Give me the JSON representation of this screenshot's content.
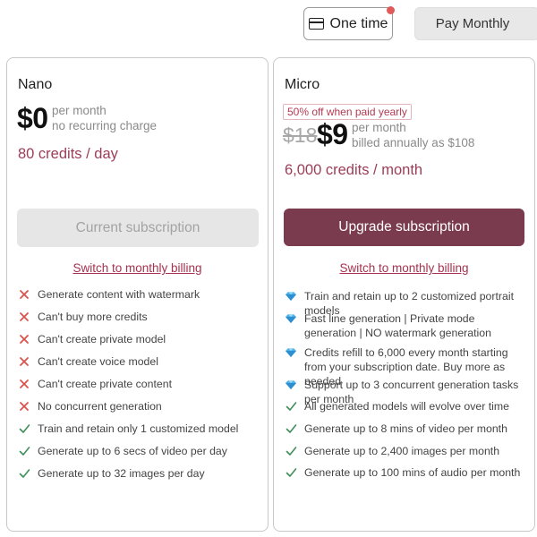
{
  "toggle": {
    "one_time_label": "One time",
    "pay_monthly_label": "Pay Monthly"
  },
  "colors": {
    "accent": "#7a3b4e",
    "credits_text": "#9c3d57",
    "link": "#a5324f",
    "cross": "#d9534f",
    "check": "#3f8f5a",
    "diamond": "#4fb3e8"
  },
  "plans": {
    "nano": {
      "name": "Nano",
      "price": "$0",
      "price_note_1": "per month",
      "price_note_2": "no recurring charge",
      "credits": "80 credits / day",
      "button_label": "Current subscription",
      "switch_label": "Switch to monthly billing",
      "features": [
        {
          "icon": "cross-icon",
          "text": "Generate content with watermark"
        },
        {
          "icon": "cross-icon",
          "text": "Can't buy more credits"
        },
        {
          "icon": "cross-icon",
          "text": "Can't create private model"
        },
        {
          "icon": "cross-icon",
          "text": "Can't create voice model"
        },
        {
          "icon": "cross-icon",
          "text": "Can't create private content"
        },
        {
          "icon": "cross-icon",
          "text": "No concurrent generation"
        },
        {
          "icon": "check-icon",
          "text": "Train and retain only 1 customized model"
        },
        {
          "icon": "check-icon",
          "text": "Generate up to 6 secs of video per day"
        },
        {
          "icon": "check-icon",
          "text": "Generate up to 32 images per day"
        }
      ]
    },
    "micro": {
      "name": "Micro",
      "discount_badge": "50% off when paid yearly",
      "old_price": "$18",
      "price": "$9",
      "price_note_1": "per month",
      "price_note_2": "billed annually as $108",
      "credits": "6,000 credits / month",
      "button_label": "Upgrade subscription",
      "switch_label": "Switch to monthly billing",
      "features": [
        {
          "icon": "diamond-icon",
          "text": "Train and retain up to 2 customized portrait models"
        },
        {
          "icon": "diamond-icon",
          "text": "Fast line generation | Private mode generation | NO watermark generation"
        },
        {
          "icon": "diamond-icon",
          "text": "Credits refill to 6,000 every month starting from your subscription date. Buy more as needed"
        },
        {
          "icon": "diamond-icon",
          "text": "Support up to 3 concurrent generation tasks per month"
        },
        {
          "icon": "check-icon",
          "text": "All generated models will evolve over time"
        },
        {
          "icon": "check-icon",
          "text": "Generate up to 8 mins of video per month"
        },
        {
          "icon": "check-icon",
          "text": "Generate up to 2,400 images per month"
        },
        {
          "icon": "check-icon",
          "text": "Generate up to 100 mins of audio per month"
        }
      ]
    }
  }
}
